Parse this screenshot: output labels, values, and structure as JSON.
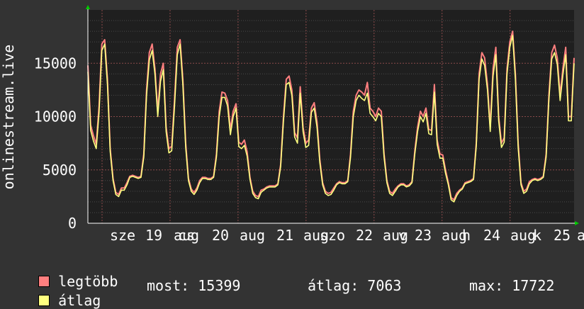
{
  "chart_data": {
    "type": "line",
    "ylabel": "onlinestream.live",
    "yticks": [
      0,
      5000,
      10000,
      15000
    ],
    "ylim": [
      0,
      20000
    ],
    "grid": true,
    "x_tick_labels": [
      "sze",
      "19",
      "aug",
      "cs",
      "20",
      "aug",
      "21",
      "aug",
      "szo",
      "22",
      "aug",
      "v",
      "23",
      "aug",
      "h",
      "24",
      "aug",
      "k",
      "25",
      "a"
    ],
    "series": [
      {
        "name": "legtöbb",
        "color": "#ff7f7f",
        "values": [
          14800,
          9200,
          8200,
          7400,
          11000,
          16800,
          17200,
          13500,
          7000,
          4200,
          2900,
          2700,
          3300,
          3300,
          3800,
          4400,
          4500,
          4400,
          4300,
          4400,
          6500,
          12500,
          16000,
          16800,
          14500,
          10500,
          14000,
          15000,
          9000,
          7000,
          7200,
          11500,
          16500,
          17200,
          13500,
          7500,
          4200,
          3200,
          2900,
          3300,
          4000,
          4300,
          4300,
          4200,
          4200,
          4400,
          6500,
          10500,
          12300,
          12200,
          11500,
          8800,
          10500,
          11200,
          7600,
          7400,
          7800,
          6700,
          4300,
          3000,
          2600,
          2500,
          3100,
          3200,
          3400,
          3500,
          3500,
          3500,
          3700,
          5500,
          10000,
          13500,
          13800,
          12500,
          8500,
          8000,
          12800,
          9000,
          7500,
          7800,
          10800,
          11300,
          9500,
          6000,
          3800,
          3000,
          2800,
          2900,
          3300,
          3700,
          3900,
          3800,
          3800,
          4000,
          6500,
          10500,
          12000,
          12500,
          12300,
          12000,
          13200,
          10800,
          10500,
          10000,
          10800,
          10500,
          6500,
          4000,
          3000,
          2800,
          3200,
          3500,
          3700,
          3700,
          3500,
          3600,
          3900,
          6800,
          9000,
          10500,
          10000,
          10800,
          8800,
          8700,
          13000,
          7800,
          6500,
          6400,
          5000,
          3800,
          2400,
          2200,
          2800,
          3100,
          3300,
          3800,
          3900,
          4000,
          4200,
          7500,
          14000,
          16000,
          15500,
          13000,
          9000,
          14500,
          16500,
          10000,
          7500,
          8000,
          14500,
          17000,
          18000,
          14000,
          7500,
          3800,
          3000,
          3200,
          3900,
          4100,
          4200,
          4100,
          4200,
          4400,
          6500,
          12000,
          16000,
          16700,
          15500,
          12000,
          14500,
          16500,
          10000,
          10000,
          15500
        ],
        "approximate": true
      },
      {
        "name": "átlag",
        "color": "#ffff80",
        "values": [
          14200,
          8700,
          7700,
          7000,
          10400,
          16200,
          16800,
          13000,
          6700,
          4000,
          2700,
          2500,
          3100,
          3100,
          3600,
          4300,
          4400,
          4300,
          4200,
          4300,
          6200,
          12000,
          15300,
          16200,
          14000,
          10000,
          13300,
          14400,
          8600,
          6600,
          6800,
          10900,
          15800,
          16800,
          13000,
          7100,
          4000,
          3000,
          2700,
          3100,
          3800,
          4200,
          4200,
          4100,
          4100,
          4300,
          6200,
          10000,
          11800,
          11800,
          11000,
          8300,
          10000,
          10800,
          7200,
          7000,
          7300,
          6300,
          4100,
          2800,
          2400,
          2300,
          2900,
          3100,
          3300,
          3400,
          3400,
          3400,
          3600,
          5300,
          9600,
          13000,
          13200,
          12000,
          8100,
          7500,
          12200,
          8600,
          7100,
          7300,
          10400,
          10800,
          9000,
          5700,
          3600,
          2800,
          2600,
          2700,
          3100,
          3600,
          3800,
          3700,
          3700,
          3900,
          6200,
          10000,
          11500,
          12000,
          11700,
          11500,
          12200,
          10300,
          10000,
          9600,
          10300,
          10000,
          6200,
          3800,
          2800,
          2600,
          3000,
          3400,
          3600,
          3600,
          3400,
          3500,
          3800,
          6500,
          8600,
          10000,
          9500,
          10300,
          8400,
          8300,
          12300,
          7400,
          6100,
          6100,
          4700,
          3600,
          2200,
          2000,
          2600,
          3000,
          3200,
          3700,
          3800,
          3900,
          4100,
          7200,
          13500,
          15400,
          14800,
          12500,
          8600,
          13800,
          15800,
          9600,
          7100,
          7600,
          14000,
          16500,
          17600,
          13500,
          7100,
          3600,
          2800,
          3000,
          3700,
          4000,
          4100,
          4000,
          4100,
          4300,
          6200,
          11600,
          15400,
          16000,
          14900,
          11500,
          13900,
          15800,
          9600,
          9600,
          15000
        ],
        "approximate": true
      }
    ]
  },
  "legend": {
    "max_label": "legtöbb",
    "avg_label": "átlag",
    "swatch_max_color": "#ff7f7f",
    "swatch_avg_color": "#ffff80"
  },
  "stats": {
    "now": "most: 15399",
    "avg": "átlag: 7063",
    "max": "max: 17722"
  }
}
